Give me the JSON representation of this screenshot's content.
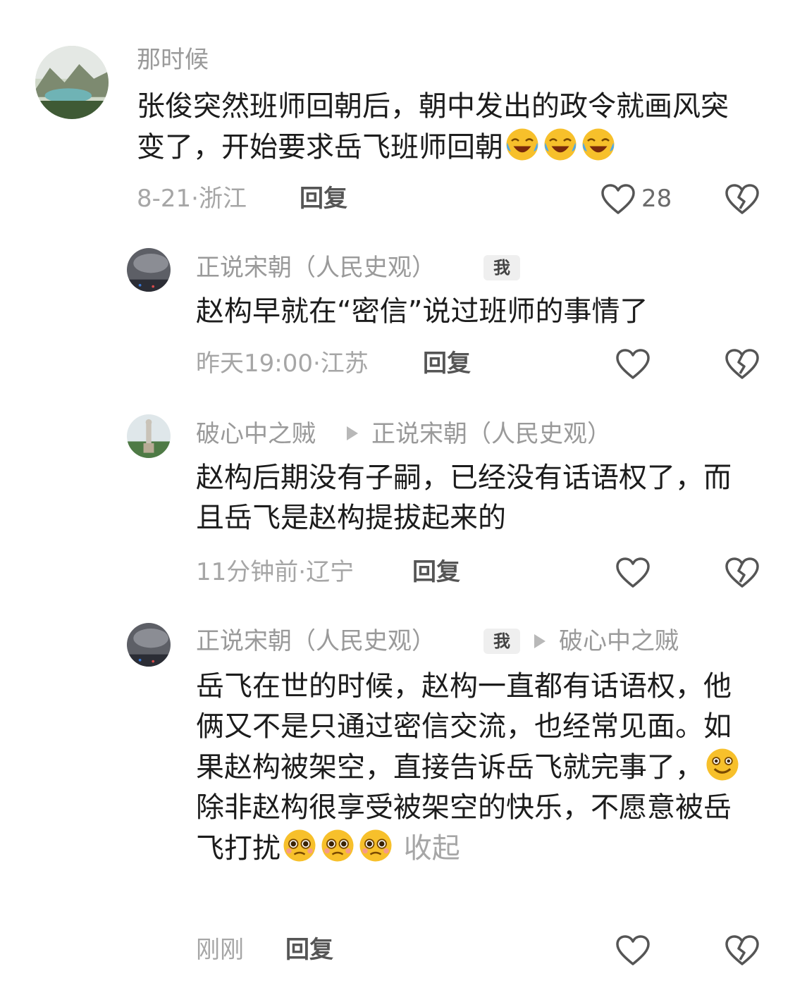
{
  "comments": [
    {
      "user": "那时候",
      "text": "张俊突然班师回朝后，朝中发出的政令就画风突变了，开始要求岳飞班师回朝",
      "emoji": "laughing-crying",
      "meta": "8-21·浙江",
      "reply": "回复",
      "likes": "28"
    },
    {
      "user": "正说宋朝（人民史观）",
      "badge": "我",
      "text": "赵构早就在“密信”说过班师的事情了",
      "meta": "昨天19:00·江苏",
      "reply": "回复"
    },
    {
      "user": "破心中之贼",
      "reply_to": "正说宋朝（人民史观）",
      "text": "赵构后期没有子嗣，已经没有话语权了，而且岳飞是赵构提拔起来的",
      "meta": "11分钟前·辽宁",
      "reply": "回复"
    },
    {
      "user": "正说宋朝（人民史观）",
      "badge": "我",
      "reply_to": "破心中之贼",
      "text_part1": "岳飞在世的时候，赵构一直都有话语权，他俩又不是只通过密信交流，也经常见面。如果赵构被架空，直接告诉岳飞就完事了，",
      "text_part2": "除非赵构很享受被架空的快乐，不愿意被岳飞打扰",
      "collapse": "收起",
      "meta": "刚刚",
      "reply": "回复"
    }
  ],
  "colors": {
    "text": "#1c1c1c",
    "muted": "#a6a6a6",
    "username": "#9a9a9a"
  },
  "icons": [
    "heart-icon",
    "broken-heart-icon",
    "laughing-crying-emoji",
    "grin-emoji",
    "pleading-emoji"
  ]
}
